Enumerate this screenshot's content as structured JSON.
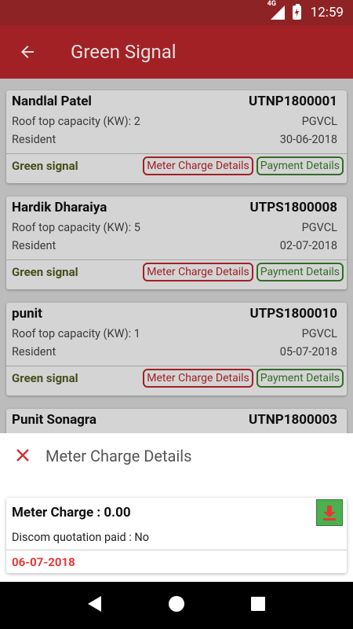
{
  "status_bar": {
    "network": "4G",
    "time": "12:59"
  },
  "app_bar": {
    "title": "Green Signal"
  },
  "cards": [
    {
      "name": "Nandlal Patel",
      "code": "UTNP1800001",
      "capacity": "Roof top capacity (KW): 2",
      "discom": "PGVCL",
      "category": "Resident",
      "date": "30-06-2018",
      "status": "Green signal",
      "meter_btn": "Meter Charge Details",
      "payment_btn": "Payment Details"
    },
    {
      "name": "Hardik Dharaiya",
      "code": "UTPS1800008",
      "capacity": "Roof top capacity (KW): 5",
      "discom": "PGVCL",
      "category": "Resident",
      "date": "02-07-2018",
      "status": "Green signal",
      "meter_btn": "Meter Charge Details",
      "payment_btn": "Payment Details"
    },
    {
      "name": "punit",
      "code": "UTPS1800010",
      "capacity": "Roof top capacity (KW): 1",
      "discom": "PGVCL",
      "category": "Resident",
      "date": "05-07-2018",
      "status": "Green signal",
      "meter_btn": "Meter Charge Details",
      "payment_btn": "Payment Details"
    },
    {
      "name": "Punit Sonagra",
      "code": "UTNP1800003"
    }
  ],
  "sheet": {
    "title": "Meter Charge Details",
    "meter_charge": "Meter Charge : 0.00",
    "quotation": "Discom quotation paid : No",
    "date": "06-07-2018"
  },
  "colors": {
    "primary": "#b8262b",
    "status_bar": "#8e2326",
    "signal_green": "#4e5a1f",
    "date_red": "#e53935",
    "download_green": "#4caf50"
  }
}
